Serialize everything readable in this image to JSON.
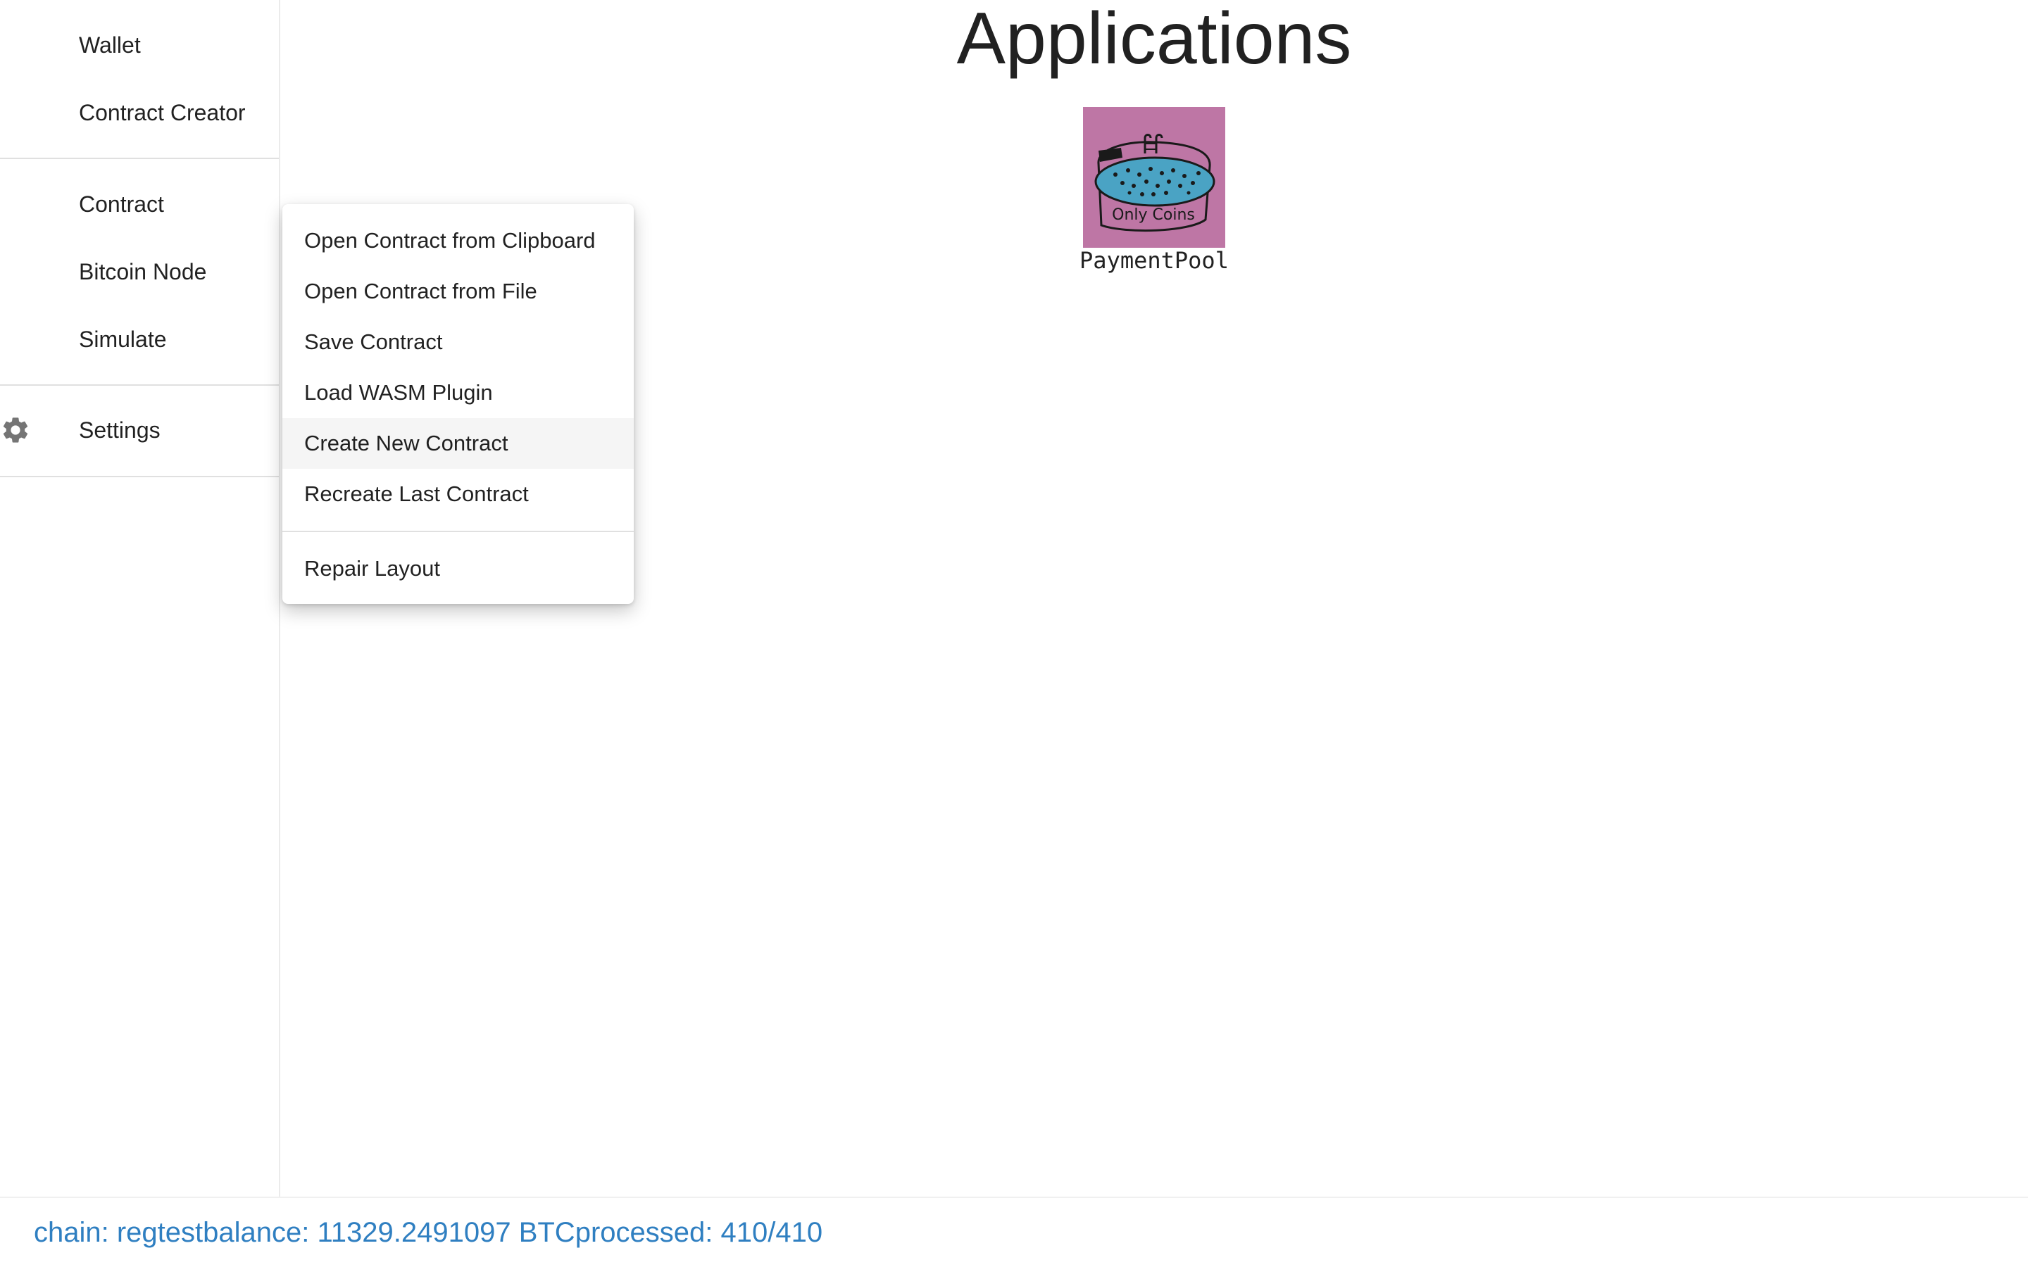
{
  "sidebar": {
    "items": [
      {
        "label": "Wallet"
      },
      {
        "label": "Contract Creator"
      },
      {
        "label": "Contract"
      },
      {
        "label": "Bitcoin Node"
      },
      {
        "label": "Simulate"
      },
      {
        "label": "Settings",
        "icon": "gear-icon"
      }
    ]
  },
  "main": {
    "title": "Applications",
    "apps": [
      {
        "label": "PaymentPool",
        "icon_text": "Only Coins",
        "icon": "pool-drawing-icon"
      }
    ]
  },
  "context_menu": {
    "items": [
      {
        "label": "Open Contract from Clipboard"
      },
      {
        "label": "Open Contract from File"
      },
      {
        "label": "Save Contract"
      },
      {
        "label": "Load WASM Plugin"
      },
      {
        "label": "Create New Contract",
        "highlighted": true
      },
      {
        "label": "Recreate Last Contract"
      },
      {
        "label": "Repair Layout"
      }
    ]
  },
  "status": {
    "chain": "chain: regtest",
    "balance": "balance: 11329.2491097 BTC",
    "processed": "processed: 410/410"
  },
  "colors": {
    "status_text": "#2f7fc1",
    "app_icon_bg": "#be76a5",
    "pool_water": "#4aa3c4",
    "menu_hover": "#f5f5f5",
    "gear": "#757575"
  }
}
